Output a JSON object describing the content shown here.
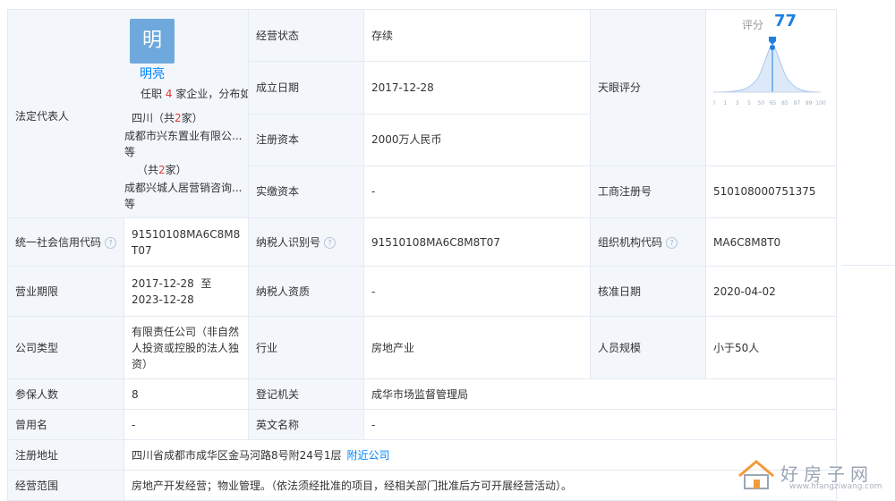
{
  "rep": {
    "label": "法定代表人",
    "avatar_char": "明",
    "name": "明亮",
    "jobs_prefix": "任职",
    "jobs_count": "4",
    "jobs_suffix": "家企业，分布如下",
    "group1_region": "四川（共",
    "group1_count": "2",
    "group1_tail": "家）",
    "group1_company": "成都市兴东置业有限公...",
    "group1_more": "等",
    "group2_region": "（共",
    "group2_count": "2",
    "group2_tail": "家）",
    "group2_company": "成都兴城人居营销咨询...",
    "group2_more": "等"
  },
  "rows": {
    "status_label": "经营状态",
    "status_value": "存续",
    "founded_label": "成立日期",
    "founded_value": "2017-12-28",
    "capital_label": "注册资本",
    "capital_value": "2000万人民币",
    "paid_label": "实缴资本",
    "paid_value": "-",
    "score_label": "天眼评分",
    "reg_no_label": "工商注册号",
    "reg_no_value": "510108000751375",
    "credit_label": "统一社会信用代码",
    "credit_value": "91510108MA6C8M8T07",
    "tax_label": "纳税人识别号",
    "tax_value": "91510108MA6C8M8T07",
    "org_label": "组织机构代码",
    "org_value": "MA6C8M8T0",
    "term_label": "营业期限",
    "term_value": "2017-12-28  至 2023-12-28",
    "taxq_label": "纳税人资质",
    "taxq_value": "-",
    "approve_label": "核准日期",
    "approve_value": "2020-04-02",
    "type_label": "公司类型",
    "type_value": "有限责任公司（非自然人投资或控股的法人独资）",
    "industry_label": "行业",
    "industry_value": "房地产业",
    "staff_label": "人员规模",
    "staff_value": "小于50人",
    "insured_label": "参保人数",
    "insured_value": "8",
    "authority_label": "登记机关",
    "authority_value": "成华市场监督管理局",
    "former_label": "曾用名",
    "former_value": "-",
    "english_label": "英文名称",
    "english_value": "-",
    "address_label": "注册地址",
    "address_value": "四川省成都市成华区金马河路8号附24号1层",
    "address_link": "附近公司",
    "scope_label": "经营范围",
    "scope_value": "房地产开发经营；物业管理。（依法须经批准的项目，经相关部门批准后方可开展经营活动）。"
  },
  "score": {
    "title": "评分",
    "value": 77,
    "ticks": [
      "0",
      "1",
      "3",
      "5",
      "50",
      "65",
      "85",
      "97",
      "99",
      "100"
    ],
    "accent": "#1f7fe0"
  },
  "watermark": {
    "title": "好房子网",
    "url": "www.hfangziwang.com"
  }
}
